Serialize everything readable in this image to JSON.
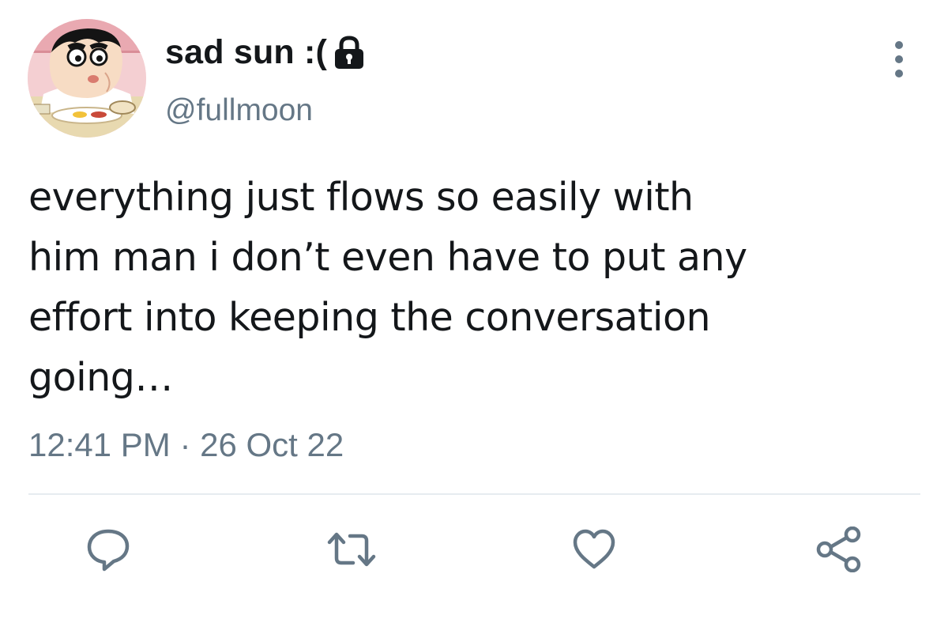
{
  "user": {
    "display_name": "sad sun :(",
    "handle": "@fullmoon",
    "avatar": "cartoon-boy-avatar",
    "protected_icon": "lock-icon"
  },
  "tweet": {
    "text_lines": [
      "everything just flows so easily with",
      "him man i don’t even have to put any",
      "effort into keeping the conversation",
      "going…"
    ],
    "timestamp": "12:41 PM · 26 Oct 22"
  },
  "actions": [
    {
      "name": "reply",
      "icon": "speech-bubble-icon"
    },
    {
      "name": "retweet",
      "icon": "retweet-arrows-icon"
    },
    {
      "name": "like",
      "icon": "heart-icon"
    },
    {
      "name": "share",
      "icon": "share-nodes-icon"
    }
  ],
  "colors": {
    "text": "#14171a",
    "secondary": "#657786",
    "divider": "#e6ecf0"
  }
}
